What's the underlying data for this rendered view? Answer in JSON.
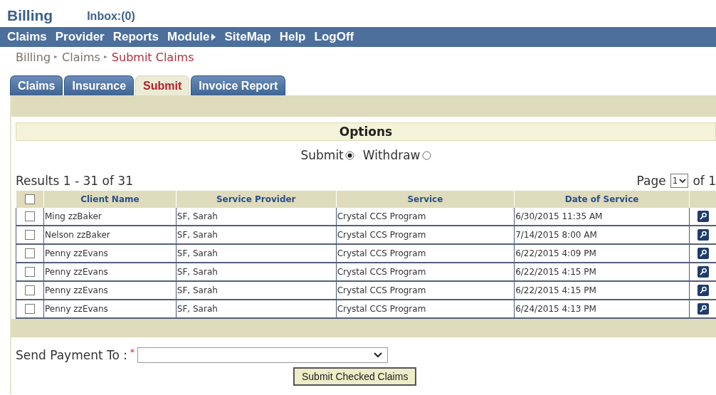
{
  "header": {
    "title": "Billing",
    "inbox": "Inbox:(0)"
  },
  "menu": [
    {
      "label": "Claims",
      "submenu": false
    },
    {
      "label": "Provider",
      "submenu": false
    },
    {
      "label": "Reports",
      "submenu": false
    },
    {
      "label": "Module",
      "submenu": true
    },
    {
      "label": "SiteMap",
      "submenu": false
    },
    {
      "label": "Help",
      "submenu": false
    },
    {
      "label": "LogOff",
      "submenu": false
    }
  ],
  "breadcrumb": [
    {
      "label": "Billing",
      "current": false
    },
    {
      "label": "Claims",
      "current": false
    },
    {
      "label": "Submit Claims",
      "current": true
    }
  ],
  "tabs": [
    {
      "label": "Claims",
      "selected": false
    },
    {
      "label": "Insurance",
      "selected": false
    },
    {
      "label": "Submit",
      "selected": true
    },
    {
      "label": "Invoice Report",
      "selected": false
    }
  ],
  "options": {
    "title": "Options",
    "radios": [
      {
        "label": "Submit",
        "selected": true
      },
      {
        "label": "Withdraw",
        "selected": false
      }
    ]
  },
  "results": "Results 1 - 31 of 31",
  "pager": {
    "label": "Page",
    "value": "1",
    "suffix": "of 1"
  },
  "table": {
    "select_all_checked": false,
    "columns": [
      "Client Name",
      "Service Provider",
      "Service",
      "Date of Service"
    ],
    "rows": [
      {
        "checked": false,
        "cells": [
          "Ming zzBaker",
          "SF, Sarah",
          "Crystal CCS Program",
          "6/30/2015 11:35 AM"
        ]
      },
      {
        "checked": false,
        "cells": [
          "Nelson zzBaker",
          "SF, Sarah",
          "Crystal CCS Program",
          "7/14/2015 8:00 AM"
        ]
      },
      {
        "checked": false,
        "cells": [
          "Penny zzEvans",
          "SF, Sarah",
          "Crystal CCS Program",
          "6/22/2015 4:09 PM"
        ]
      },
      {
        "checked": false,
        "cells": [
          "Penny zzEvans",
          "SF, Sarah",
          "Crystal CCS Program",
          "6/22/2015 4:15 PM"
        ]
      },
      {
        "checked": false,
        "cells": [
          "Penny zzEvans",
          "SF, Sarah",
          "Crystal CCS Program",
          "6/22/2015 4:15 PM"
        ]
      },
      {
        "checked": false,
        "cells": [
          "Penny zzEvans",
          "SF, Sarah",
          "Crystal CCS Program",
          "6/24/2015 4:13 PM"
        ]
      }
    ]
  },
  "send_payment": {
    "label": "Send Payment To :",
    "required_mark": "*"
  },
  "submit_button": "Submit Checked Claims"
}
